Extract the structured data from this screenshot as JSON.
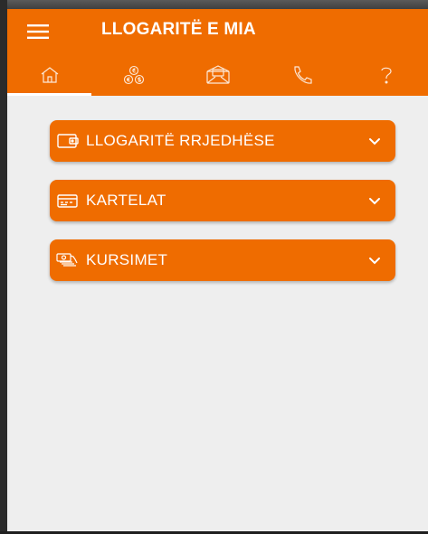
{
  "app": {
    "title": "LLOGARITË E MIA"
  },
  "colors": {
    "accent": "#ef6c00",
    "background": "#eeeeee",
    "text_on_accent": "#ffffff"
  },
  "tabs": [
    {
      "icon": "home-icon",
      "active": true
    },
    {
      "icon": "currency-exchange-icon",
      "active": false
    },
    {
      "icon": "envelope-icon",
      "active": false
    },
    {
      "icon": "phone-icon",
      "active": false
    },
    {
      "icon": "question-icon",
      "active": false
    }
  ],
  "sections": [
    {
      "label": "LLOGARITË RRJEDHËSE",
      "icon": "wallet-icon"
    },
    {
      "label": "KARTELAT",
      "icon": "card-icon"
    },
    {
      "label": "KURSIMET",
      "icon": "money-stack-icon"
    }
  ]
}
